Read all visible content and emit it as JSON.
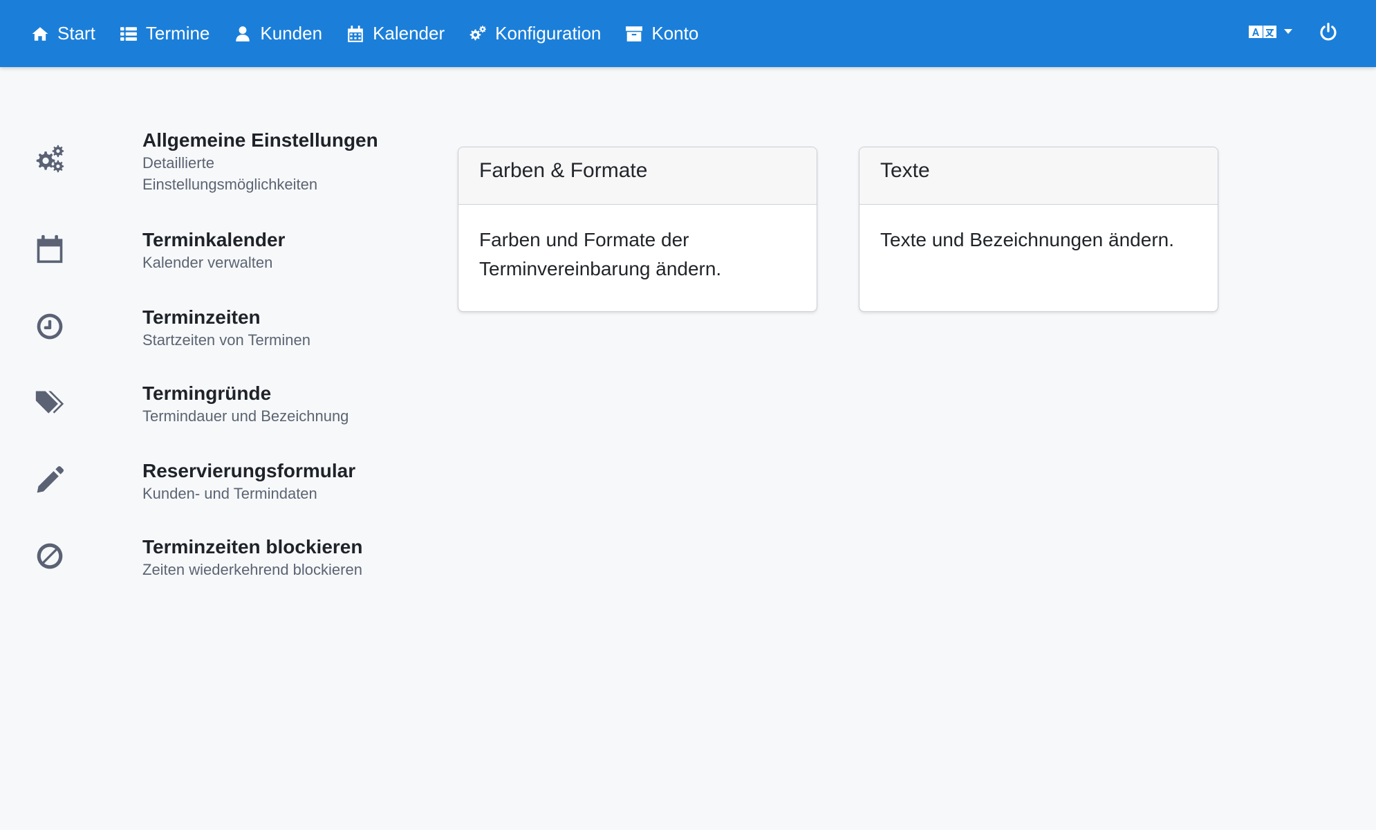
{
  "nav": {
    "items": [
      {
        "label": "Start",
        "icon": "home-icon"
      },
      {
        "label": "Termine",
        "icon": "list-icon"
      },
      {
        "label": "Kunden",
        "icon": "user-icon"
      },
      {
        "label": "Kalender",
        "icon": "calendar-grid-icon"
      },
      {
        "label": "Konfiguration",
        "icon": "gears-icon"
      },
      {
        "label": "Konto",
        "icon": "archive-icon"
      }
    ],
    "language_icon": "translate-icon",
    "power_icon": "power-icon"
  },
  "sidebar": {
    "items": [
      {
        "title": "Allgemeine Einstellungen",
        "subtitle": "Detaillierte Einstellungsmöglichkeiten",
        "icon": "gears-icon"
      },
      {
        "title": "Terminkalender",
        "subtitle": "Kalender verwalten",
        "icon": "calendar-icon"
      },
      {
        "title": "Terminzeiten",
        "subtitle": "Startzeiten von Terminen",
        "icon": "clock-icon"
      },
      {
        "title": "Termingründe",
        "subtitle": "Termindauer und Bezeichnung",
        "icon": "tags-icon"
      },
      {
        "title": "Reservierungsformular",
        "subtitle": "Kunden- und Termindaten",
        "icon": "pencil-icon"
      },
      {
        "title": "Terminzeiten blockieren",
        "subtitle": "Zeiten wiederkehrend blockieren",
        "icon": "ban-icon"
      }
    ]
  },
  "cards": [
    {
      "title": "Farben & Formate",
      "text": "Farben und Formate der Terminvereinbarung ändern."
    },
    {
      "title": "Texte",
      "text": "Texte und Bezeichnungen ändern."
    }
  ],
  "colors": {
    "navbar": "#1b7fd9",
    "background": "#f7f8fa",
    "icon_gray": "#5a6274"
  }
}
